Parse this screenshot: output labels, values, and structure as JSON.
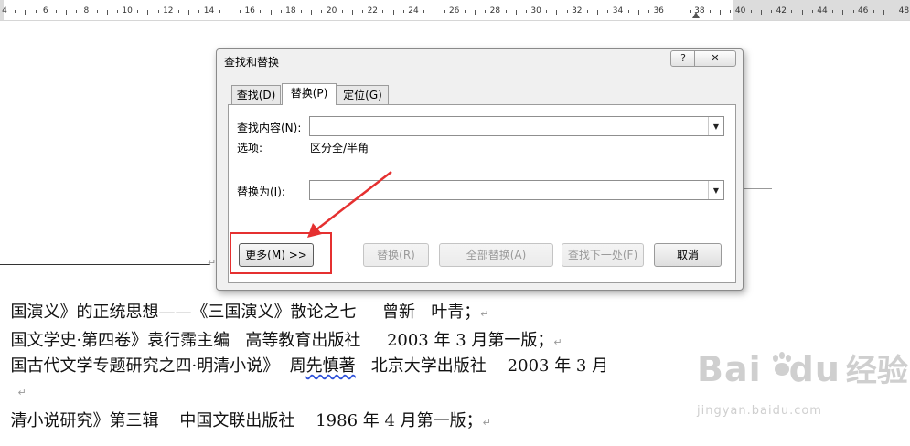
{
  "ruler": {
    "numbers": [
      "4",
      "6",
      "8",
      "10",
      "12",
      "14",
      "16",
      "18",
      "20",
      "22",
      "24",
      "26",
      "28",
      "30",
      "32",
      "34",
      "36",
      "38",
      "40",
      "42",
      "44",
      "46",
      "48"
    ]
  },
  "document": {
    "lines": [
      {
        "text": "国演义》的正统思想——《三国演义》散论之七     曾新   叶青；",
        "mark": "↵"
      },
      {
        "text": "国文学史·第四卷》袁行霈主编   高等教育出版社     2003 年 3 月第一版；",
        "mark": "↵"
      },
      {
        "text_a": "国古代文学专题研究之四·明清小说》  周",
        "text_b": "先慎著",
        "text_c": "   北京大学出版社    2003 年 3 月"
      },
      {
        "text": "",
        "mark": "↵"
      },
      {
        "text": "清小说研究》第三辑    中国文联出版社    1986 年 4 月第一版；",
        "mark": "↵"
      }
    ]
  },
  "watermark": {
    "brand": "Bai",
    "brand2": "du",
    "cn": "经验",
    "url": "jingyan.baidu.com"
  },
  "dialog": {
    "title": "查找和替换",
    "help": "?",
    "close": "✕",
    "tabs": [
      {
        "label": "查找(D)"
      },
      {
        "label": "替换(P)",
        "active": true
      },
      {
        "label": "定位(G)"
      }
    ],
    "find_label": "查找内容(N):",
    "find_value": "",
    "options_label": "选项:",
    "options_value": "区分全/半角",
    "replace_label": "替换为(I):",
    "replace_value": "",
    "buttons": {
      "more": "更多(M) >>",
      "replace": "替换(R)",
      "replace_all": "全部替换(A)",
      "find_next": "查找下一处(F)",
      "cancel": "取消"
    }
  },
  "colors": {
    "annotation": "#e53030",
    "squiggle": "#2b4fd9"
  }
}
